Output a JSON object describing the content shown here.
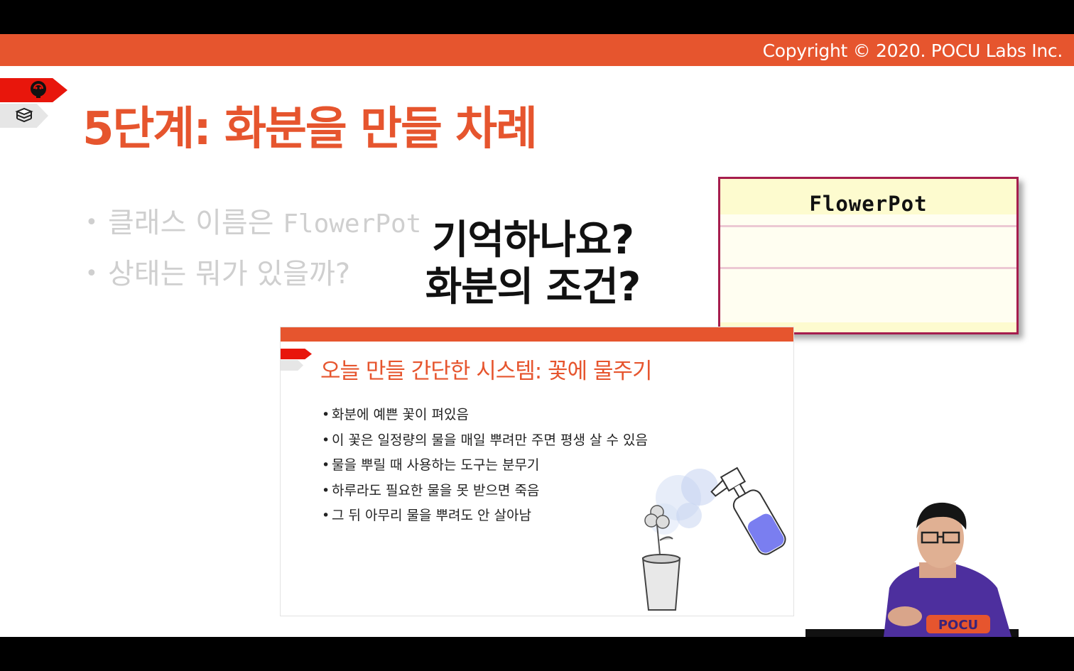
{
  "copyright": "Copyright © 2020. POCU Labs Inc.",
  "slide": {
    "title": "5단계: 화분을 만들 차례",
    "bullets": [
      {
        "text_prefix": "클래스 이름은 ",
        "text_code": "FlowerPot"
      },
      {
        "text_prefix": "상태는 뭐가 있을까?"
      }
    ],
    "icons": [
      "brain-icon",
      "books-icon"
    ]
  },
  "uml": {
    "class_name": "FlowerPot"
  },
  "overlay": {
    "line1": "기억하나요?",
    "line2": "화분의 조건?"
  },
  "inset": {
    "title": "오늘 만들 간단한 시스템: 꽃에 물주기",
    "bullets": [
      "화분에 예쁜 꽃이 펴있음",
      "이 꽃은 일정량의 물을 매일 뿌려만 주면 평생 살 수 있음",
      "물을 뿌릴 때 사용하는 도구는 분무기",
      "하루라도 필요한 물을 못 받으면 죽음",
      "그 뒤 아무리 물을 뿌려도 안 살아남"
    ],
    "art_icons": [
      "spray-bottle-icon",
      "flower-pot-icon"
    ]
  },
  "presenter": {
    "shirt_logo": "POCU"
  },
  "colors": {
    "brand_orange": "#e6552e",
    "tab_red": "#e8160c",
    "uml_border": "#a61d4d",
    "uml_fill": "#fdfbcf"
  }
}
